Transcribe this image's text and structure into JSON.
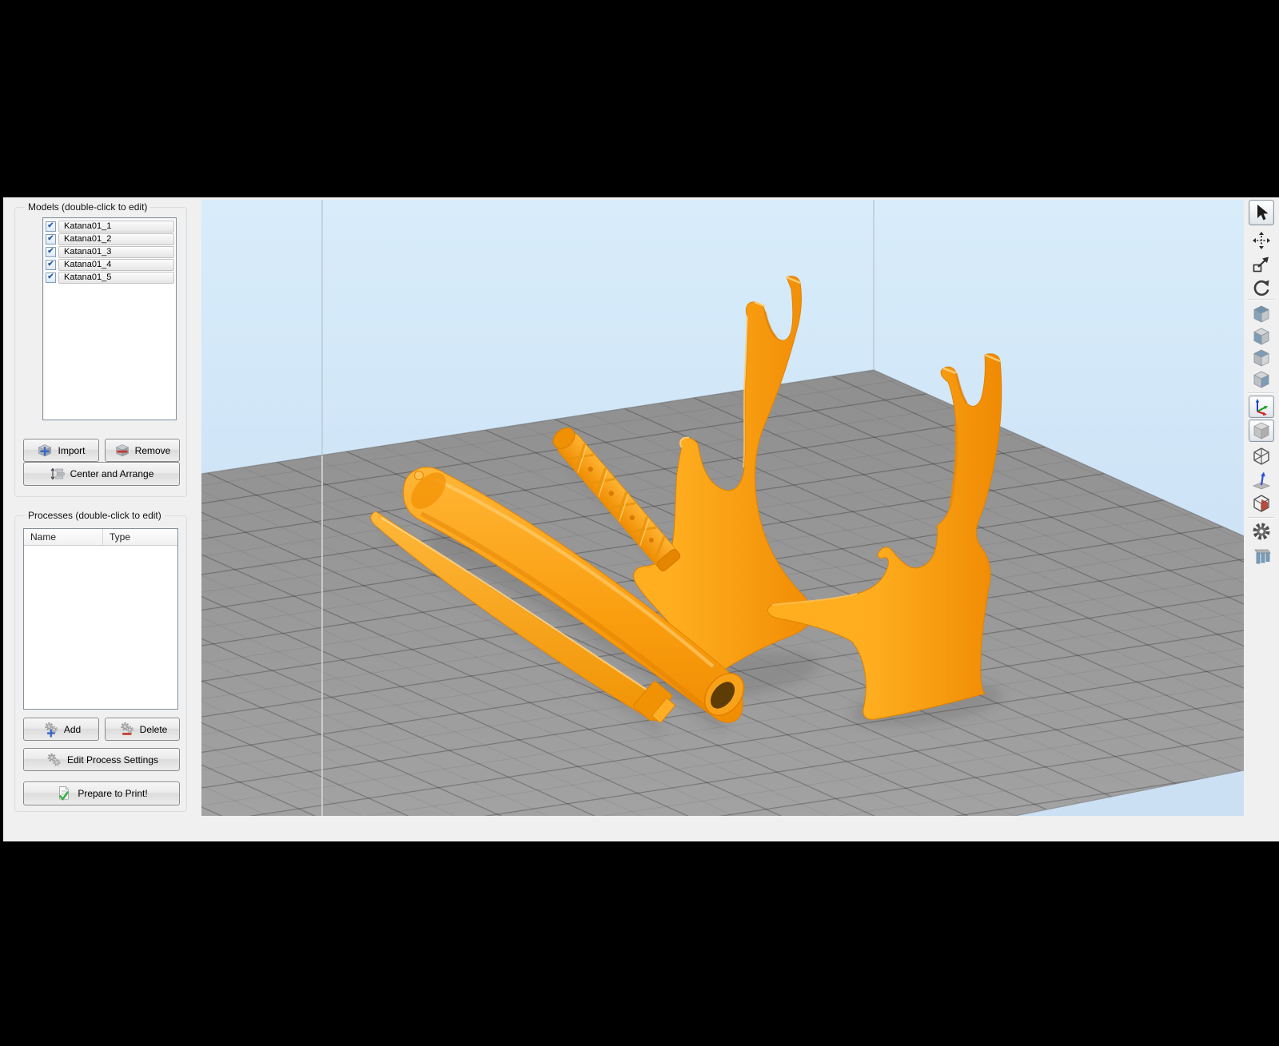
{
  "models_panel": {
    "title": "Models (double-click to edit)",
    "check_glyph": "✔",
    "items": [
      {
        "label": "Katana01_1",
        "checked": true
      },
      {
        "label": "Katana01_2",
        "checked": true
      },
      {
        "label": "Katana01_3",
        "checked": true
      },
      {
        "label": "Katana01_4",
        "checked": true
      },
      {
        "label": "Katana01_5",
        "checked": true
      }
    ],
    "import_label": "Import",
    "remove_label": "Remove",
    "center_arrange_label": "Center and Arrange"
  },
  "processes_panel": {
    "title": "Processes (double-click to edit)",
    "columns": {
      "name": "Name",
      "type": "Type"
    },
    "rows": [],
    "add_label": "Add",
    "delete_label": "Delete",
    "edit_label": "Edit Process Settings",
    "prepare_label": "Prepare to Print!"
  },
  "toolbar": {
    "icons": [
      {
        "name": "select-cursor",
        "selected": true
      },
      {
        "name": "move-model",
        "selected": false
      },
      {
        "name": "scale-model",
        "selected": false
      },
      {
        "name": "rotate-model",
        "selected": false
      },
      {
        "name": "view-cube-iso",
        "selected": false
      },
      {
        "name": "view-cube-top",
        "selected": false
      },
      {
        "name": "view-cube-front",
        "selected": false
      },
      {
        "name": "view-cube-side",
        "selected": false
      },
      {
        "name": "show-axes",
        "selected": true
      },
      {
        "name": "render-solid",
        "selected": true
      },
      {
        "name": "render-wireframe",
        "selected": false
      },
      {
        "name": "show-normals",
        "selected": false
      },
      {
        "name": "cross-section",
        "selected": false
      },
      {
        "name": "machine-settings-gear",
        "selected": false
      },
      {
        "name": "show-supports",
        "selected": false
      }
    ]
  },
  "viewport": {
    "parts": [
      "katana blade",
      "katana sheath",
      "katana wrapped handle",
      "display stand left",
      "display stand right"
    ],
    "colors": {
      "model_orange": "#ffa016",
      "plate_gray": "#9a9a9a",
      "sky_blue": "#d2e7f8"
    }
  }
}
